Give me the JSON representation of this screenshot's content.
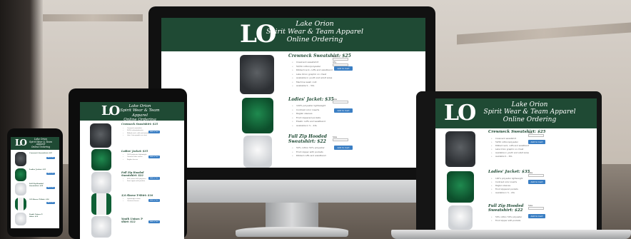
{
  "store": {
    "logo": "LO",
    "title_line1": "Lake Orion",
    "title_line2": "Spirit Wear & Team Apparel",
    "title_line3": "Online Ordering"
  },
  "products": [
    {
      "title": "Crewneck Sweatshirt: $25",
      "color": "gray",
      "bullets": [
        "Crewneck sweatshirt",
        "50/50 cotton/polyester",
        "Ribbed neck, cuffs and waistband",
        "Lake Orion graphic on chest",
        "Available in youth and adult sizes",
        "Machine wash cold",
        "Available S – 3XL"
      ]
    },
    {
      "title": "Ladies' Jacket: $35",
      "color": "green",
      "bullets": [
        "100% polyester lightweight",
        "Contrast color inserts",
        "Raglan sleeves",
        "Front zippered pockets",
        "Elastic cuffs and waistband",
        "Available in S – 2XL"
      ]
    },
    {
      "title": "Full Zip Hooded Sweatshirt: $22",
      "color": "white",
      "bullets": [
        "50% cotton 50% polyester",
        "Front zipper with pockets",
        "Ribbed cuffs and waistband"
      ]
    },
    {
      "title": "3/4 Sleeve T-Shirt: $16",
      "color": "raglan",
      "bullets": [
        "Lightweight cotton",
        "Contrast sleeves"
      ]
    },
    {
      "title": "Youth Unisex T-Shirt: $12",
      "color": "white",
      "bullets": [
        "Crew neck"
      ]
    }
  ],
  "options": {
    "size_label": "Size",
    "size_value": "Large",
    "qty_label": "Qty",
    "qty_value": "1"
  },
  "add_to_cart": "Add to Cart",
  "colors": {
    "header_green": "#1f4a34",
    "button_blue": "#3b7fc4"
  }
}
